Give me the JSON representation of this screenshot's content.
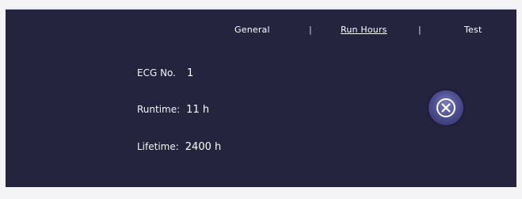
{
  "nav": {
    "tabs": [
      {
        "label": "General",
        "active": false
      },
      {
        "label": "Run Hours",
        "active": true
      },
      {
        "label": "Test",
        "active": false
      }
    ],
    "separator": "|"
  },
  "info": {
    "ecg_label": "ECG No.",
    "ecg_value": "1",
    "runtime_label": "Runtime:",
    "runtime_value": "11 h",
    "lifetime_label": "Lifetime:",
    "lifetime_value": "2400 h"
  },
  "close_button": {
    "icon": "close-circle-icon"
  },
  "colors": {
    "panel_bg": "#25243f",
    "text": "#ffffff",
    "button_accent": "#4f4f93"
  }
}
